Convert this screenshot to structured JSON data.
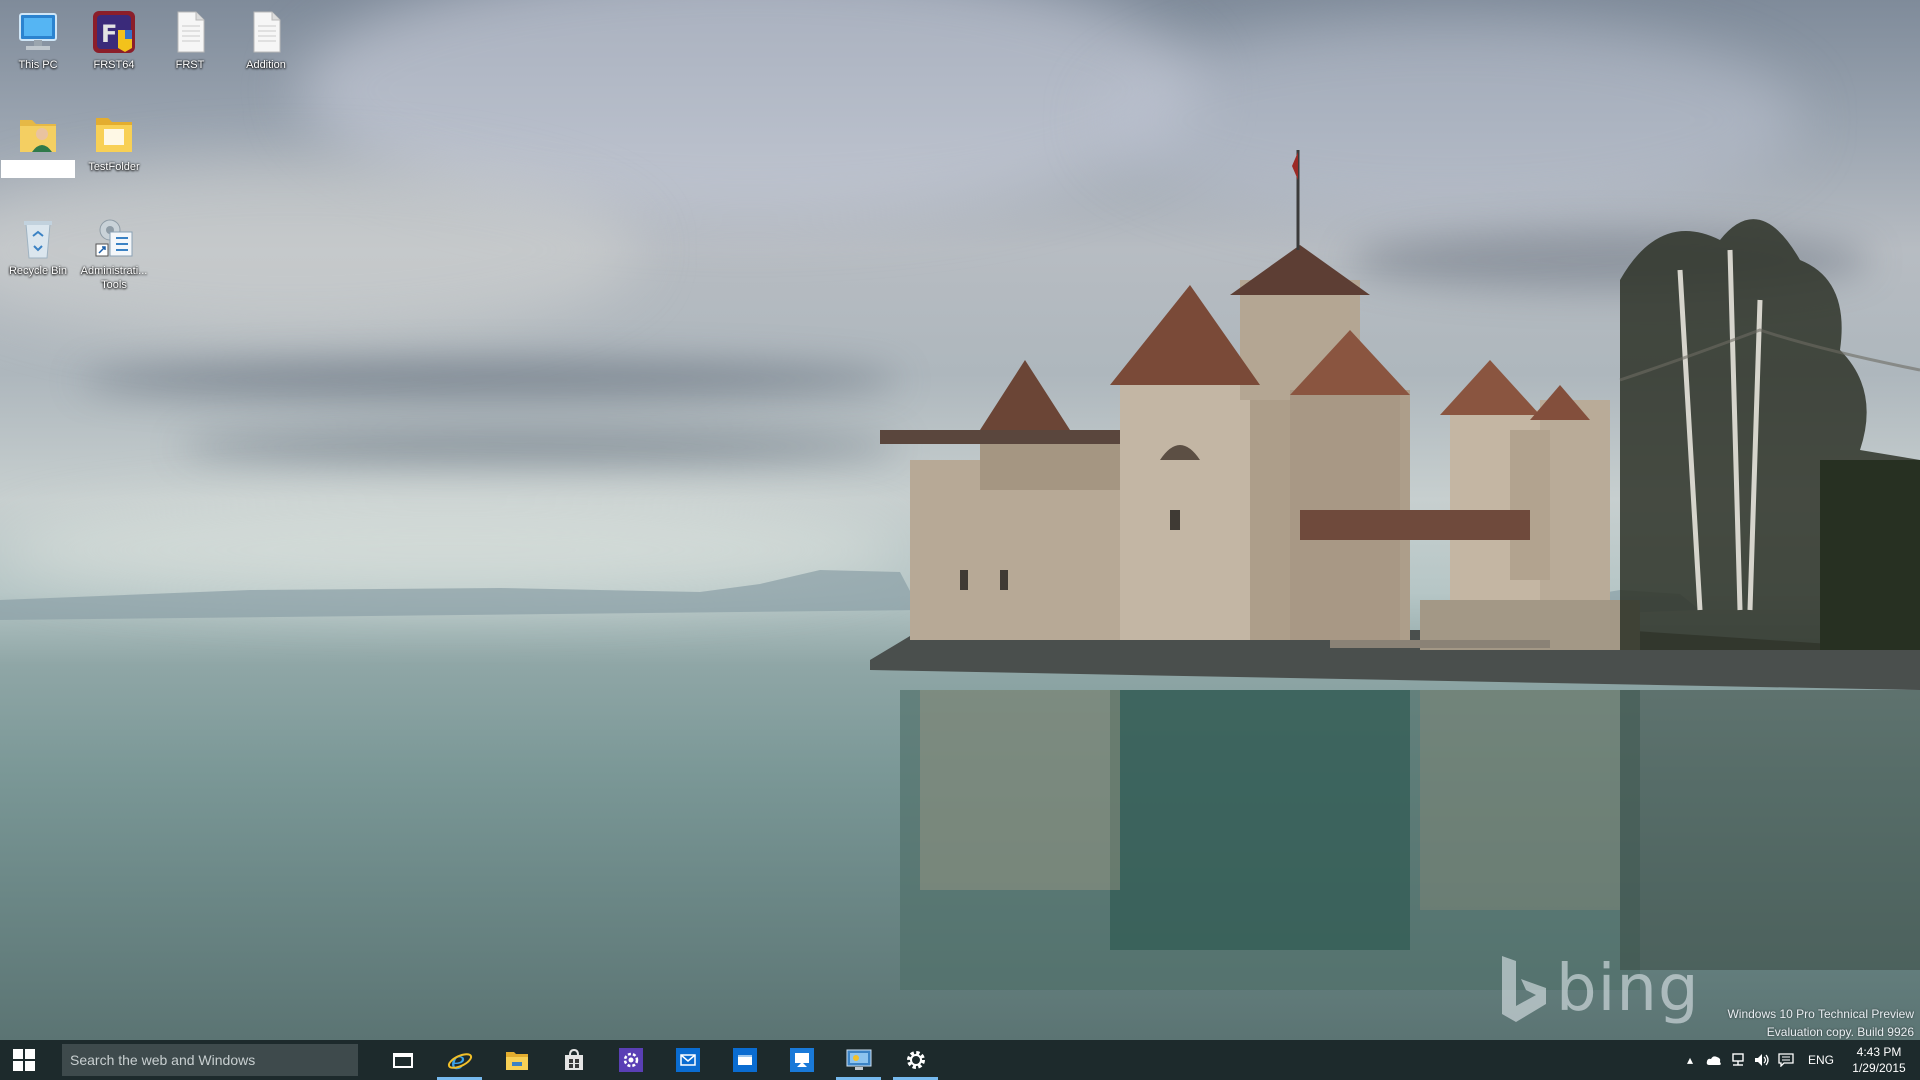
{
  "desktop_icons": [
    {
      "label": "This PC",
      "icon": "monitor-icon"
    },
    {
      "label": "FRST64",
      "icon": "frst-app-icon"
    },
    {
      "label": "FRST",
      "icon": "text-file-icon"
    },
    {
      "label": "Addition",
      "icon": "text-file-icon"
    },
    {
      "label": "",
      "icon": "user-folder-icon"
    },
    {
      "label": "TestFolder",
      "icon": "folder-icon"
    },
    {
      "label": "Recycle Bin",
      "icon": "recycle-bin-icon"
    },
    {
      "label": "Administrati... Tools",
      "icon": "admin-tools-icon"
    }
  ],
  "wallpaper": {
    "bing_logo": "bing"
  },
  "watermark": {
    "line1": "Windows 10 Pro Technical Preview",
    "line2": "Evaluation copy. Build 9926"
  },
  "taskbar": {
    "search_placeholder": "Search the web and Windows",
    "pinned_apps": [
      {
        "name": "Task View",
        "icon": "task-view-icon"
      },
      {
        "name": "Internet Explorer",
        "icon": "internet-explorer-icon"
      },
      {
        "name": "File Explorer",
        "icon": "file-explorer-icon"
      },
      {
        "name": "Store",
        "icon": "store-icon"
      },
      {
        "name": "Settings",
        "icon": "settings-app-icon"
      },
      {
        "name": "Mail",
        "icon": "mail-icon"
      },
      {
        "name": "Calendar",
        "icon": "calendar-app-icon"
      },
      {
        "name": "Remote Desktop",
        "icon": "remote-desktop-icon"
      },
      {
        "name": "Control Panel",
        "icon": "control-panel-icon"
      },
      {
        "name": "Settings",
        "icon": "gear-icon"
      }
    ],
    "tray": {
      "language": "ENG",
      "time": "4:43 PM",
      "date": "1/29/2015"
    }
  },
  "colors": {
    "taskbar_bg": "#1d2a2c",
    "running_indicator": "#76b9ed",
    "search_bg": "#3e4a4c"
  }
}
